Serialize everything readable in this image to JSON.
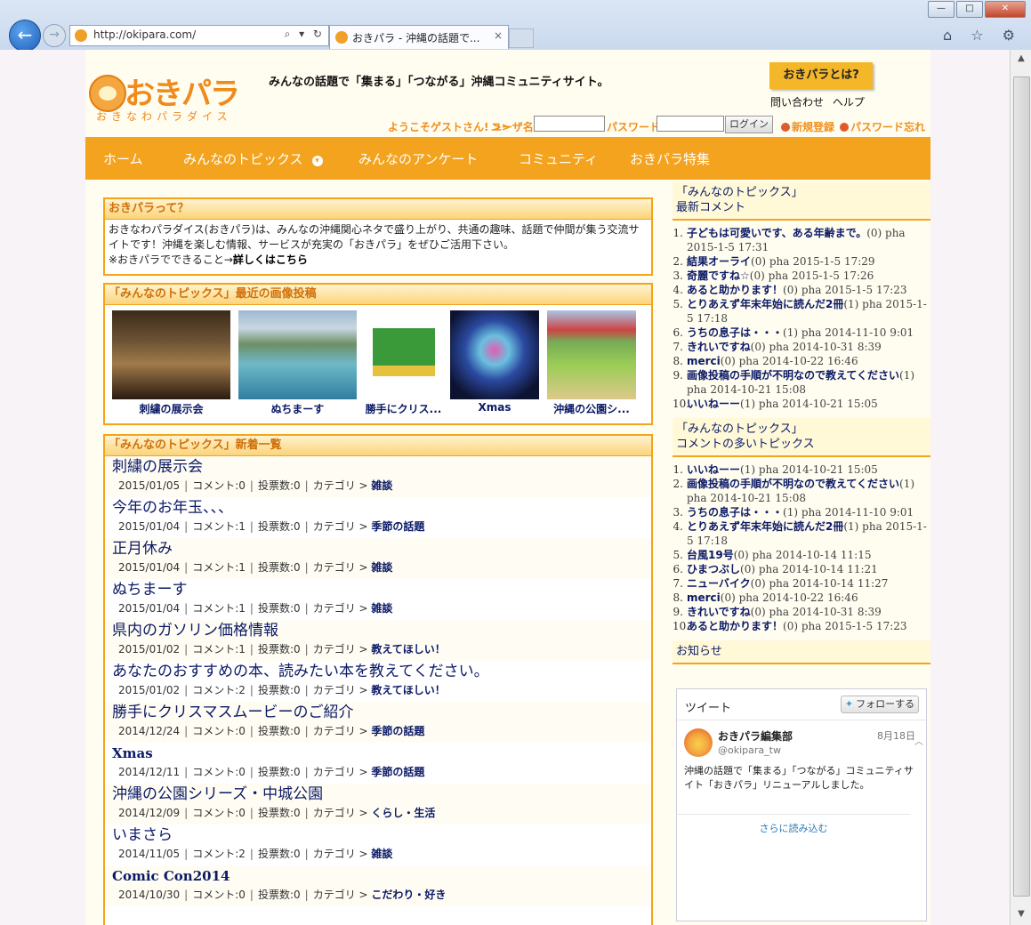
{
  "browser": {
    "url": "http://okipara.com/",
    "tab_title": "おきパラ - 沖縄の話題で...",
    "tab_close": "×",
    "back": "←",
    "forward": "→",
    "addr_tools": "⌕ ▾ ↻",
    "icons": "⌂ ☆ ⚙",
    "win": {
      "min": "—",
      "max": "□",
      "close": "✕"
    }
  },
  "header": {
    "logo_text": "おきパラ",
    "logo_sub": "おきなわパラダイス",
    "tagline": "みんなの話題で「集まる」「つながる」沖縄コミュニティサイト。",
    "about_button": "おきパラとは?",
    "contact_link": "問い合わせ",
    "help_link": "ヘルプ"
  },
  "login": {
    "welcome": "ようこそゲストさん! >>",
    "username_label": "ユーザ名",
    "password_label": "パスワード",
    "login_button": "ログイン",
    "register_link": "新規登録",
    "forgot_link": "パスワード忘れ"
  },
  "nav": {
    "items": [
      "ホーム",
      "みんなのトピックス",
      "みんなのアンケート",
      "コミュニティ",
      "おきパラ特集"
    ],
    "dropdown_icon": "▾"
  },
  "intro": {
    "heading": "おきパラって？",
    "text": "おきなわパラダイス(おきパラ)は、みんなの沖縄関心ネタで盛り上がり、共通の趣味、話題で仲間が集う交流サイトです！沖縄を楽しむ情報、サービスが充実の「おきパラ」をぜひご活用下さい。",
    "more_prefix": "※おきパラでできること→",
    "more_link": "詳しくはこちら"
  },
  "gallery": {
    "heading": "「みんなのトピックス」最近の画像投稿",
    "items": [
      {
        "caption": "刺繍の展示会"
      },
      {
        "caption": "ぬちまーす"
      },
      {
        "caption": "勝手にクリス..."
      },
      {
        "caption": "Xmas"
      },
      {
        "caption": "沖縄の公園シ..."
      }
    ]
  },
  "topics": {
    "heading": "「みんなのトピックス」新着一覧",
    "comment_label": "コメント:",
    "vote_label": "投票数:",
    "category_label": "カテゴリ >",
    "rows": [
      {
        "title": "刺繍の展示会",
        "date": "2015/01/05",
        "comments": "0",
        "votes": "0",
        "category": "雑談"
      },
      {
        "title": "今年のお年玉、、、",
        "date": "2015/01/04",
        "comments": "1",
        "votes": "0",
        "category": "季節の話題"
      },
      {
        "title": "正月休み",
        "date": "2015/01/04",
        "comments": "1",
        "votes": "0",
        "category": "雑談"
      },
      {
        "title": "ぬちまーす",
        "date": "2015/01/04",
        "comments": "1",
        "votes": "0",
        "category": "雑談"
      },
      {
        "title": "県内のガソリン価格情報",
        "date": "2015/01/02",
        "comments": "1",
        "votes": "0",
        "category": "教えてほしい！"
      },
      {
        "title": "あなたのおすすめの本、読みたい本を教えてください。",
        "date": "2015/01/02",
        "comments": "2",
        "votes": "0",
        "category": "教えてほしい！"
      },
      {
        "title": "勝手にクリスマスムービーのご紹介",
        "date": "2014/12/24",
        "comments": "0",
        "votes": "0",
        "category": "季節の話題"
      },
      {
        "title": "Xmas",
        "date": "2014/12/11",
        "comments": "0",
        "votes": "0",
        "category": "季節の話題"
      },
      {
        "title": "沖縄の公園シリーズ・中城公園",
        "date": "2014/12/09",
        "comments": "0",
        "votes": "0",
        "category": "くらし・生活"
      },
      {
        "title": "いまさら",
        "date": "2014/11/05",
        "comments": "2",
        "votes": "0",
        "category": "雑談"
      },
      {
        "title": "Comic Con2014",
        "date": "2014/10/30",
        "comments": "0",
        "votes": "0",
        "category": "こだわり・好き"
      }
    ]
  },
  "sidebar": {
    "latest_heading_1": "「みんなのトピックス」",
    "latest_heading_2": "最新コメント",
    "latest": [
      {
        "title": "子どもは可愛いです、ある年齢まで。",
        "meta": "(0) pha 2015-1-5 17:31"
      },
      {
        "title": "結果オーライ",
        "meta": "(0) pha 2015-1-5 17:29"
      },
      {
        "title": "奇麗ですね☆",
        "meta": "(0) pha 2015-1-5 17:26"
      },
      {
        "title": "あると助かります！",
        "meta": "(0) pha 2015-1-5 17:23"
      },
      {
        "title": "とりあえず年末年始に読んだ2冊",
        "meta": "(1) pha 2015-1-5 17:18"
      },
      {
        "title": "うちの息子は・・・",
        "meta": "(1) pha 2014-11-10 9:01"
      },
      {
        "title": "きれいですね",
        "meta": "(0) pha 2014-10-31 8:39"
      },
      {
        "title": "merci",
        "meta": "(0) pha 2014-10-22 16:46"
      },
      {
        "title": "画像投稿の手順が不明なので教えてください",
        "meta": "(1) pha 2014-10-21 15:08"
      },
      {
        "title": "いいねーー",
        "meta": "(1) pha 2014-10-21 15:05"
      }
    ],
    "popular_heading_1": "「みんなのトピックス」",
    "popular_heading_2": "コメントの多いトピックス",
    "popular": [
      {
        "title": "いいねーー",
        "meta": "(1) pha 2014-10-21 15:05"
      },
      {
        "title": "画像投稿の手順が不明なので教えてください",
        "meta": "(1) pha 2014-10-21 15:08"
      },
      {
        "title": "うちの息子は・・・",
        "meta": "(1) pha 2014-11-10 9:01"
      },
      {
        "title": "とりあえず年末年始に読んだ2冊",
        "meta": "(1) pha 2015-1-5 17:18"
      },
      {
        "title": "台風19号",
        "meta": "(0) pha 2014-10-14 11:15"
      },
      {
        "title": "ひまつぶし",
        "meta": "(0) pha 2014-10-14 11:21"
      },
      {
        "title": "ニューバイク",
        "meta": "(0) pha 2014-10-14 11:27"
      },
      {
        "title": "merci",
        "meta": "(0) pha 2014-10-22 16:46"
      },
      {
        "title": "きれいですね",
        "meta": "(0) pha 2014-10-31 8:39"
      },
      {
        "title": "あると助かります！",
        "meta": "(0) pha 2015-1-5 17:23"
      }
    ],
    "news_heading": "お知らせ",
    "twitter": {
      "title": "ツイート",
      "follow_button": "フォローする",
      "account_name": "おきパラ編集部",
      "handle": "@okipara_tw",
      "date": "8月18日",
      "text": "沖縄の話題で「集まる」「つながる」コミュニティサイト「おきパラ」リニューアルしました。",
      "load_more": "さらに読み込む"
    }
  }
}
